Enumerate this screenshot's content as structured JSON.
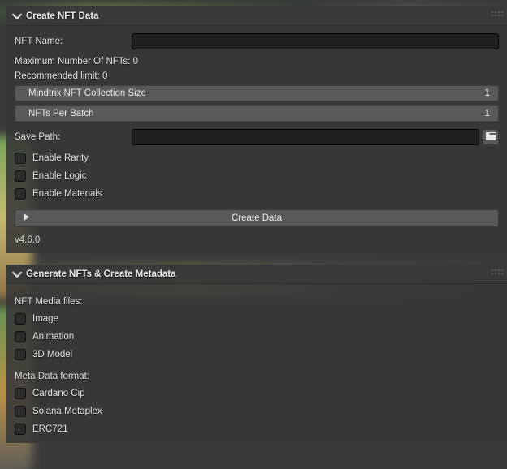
{
  "panel1": {
    "title": "Create NFT Data",
    "nft_name_label": "NFT Name:",
    "nft_name_value": "",
    "max_nfts_line": "Maximum Number Of NFTs: 0",
    "recommended_line": "Recommended limit: 0",
    "collection_size": {
      "label": "Mindtrix NFT Collection Size",
      "value": "1"
    },
    "per_batch": {
      "label": "NFTs Per Batch",
      "value": "1"
    },
    "save_path_label": "Save Path:",
    "save_path_value": "",
    "enable_rarity": "Enable Rarity",
    "enable_logic": "Enable Logic",
    "enable_materials": "Enable Materials",
    "create_data_btn": "Create Data",
    "version": "v4.6.0"
  },
  "panel2": {
    "title": "Generate NFTs & Create Metadata",
    "media_label": "NFT Media files:",
    "image": "Image",
    "animation": "Animation",
    "model3d": "3D Model",
    "meta_label": "Meta Data format:",
    "cardano": "Cardano Cip",
    "solana": "Solana Metaplex",
    "erc721": "ERC721"
  }
}
